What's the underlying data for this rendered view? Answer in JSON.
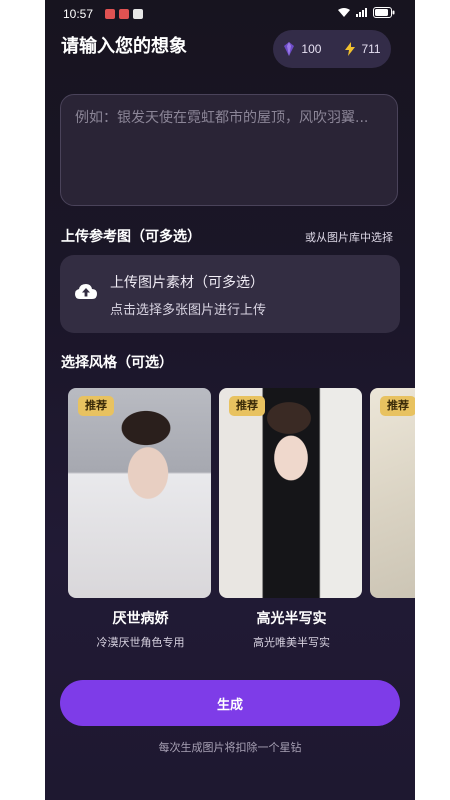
{
  "status_bar": {
    "time": "10:57",
    "battery": ""
  },
  "header": {
    "title": "请输入您的想象"
  },
  "balance": {
    "gems": "100",
    "energy": "711"
  },
  "prompt": {
    "placeholder": "例如：银发天使在霓虹都市的屋顶，风吹羽翼..."
  },
  "reference": {
    "label": "上传参考图（可多选）",
    "gallery_link": "或从图片库中选择",
    "upload_title": "上传图片素材（可多选）",
    "upload_subtitle": "点击选择多张图片进行上传"
  },
  "styles": {
    "label": "选择风格（可选）",
    "items": [
      {
        "badge": "推荐",
        "name": "厌世病娇",
        "desc": "冷漠厌世角色专用"
      },
      {
        "badge": "推荐",
        "name": "高光半写实",
        "desc": "高光唯美半写实"
      },
      {
        "badge": "推荐",
        "name": "",
        "desc": ""
      }
    ]
  },
  "action": {
    "generate_label": "生成",
    "note": "每次生成图片将扣除一个星钻"
  },
  "colors": {
    "accent": "#7e3ce8",
    "badge": "#e8c260",
    "background": "#1b1629"
  },
  "icons": [
    "gem-icon",
    "lightning-icon",
    "cloud-upload-icon",
    "wifi-icon",
    "signal-icon",
    "battery-icon"
  ]
}
